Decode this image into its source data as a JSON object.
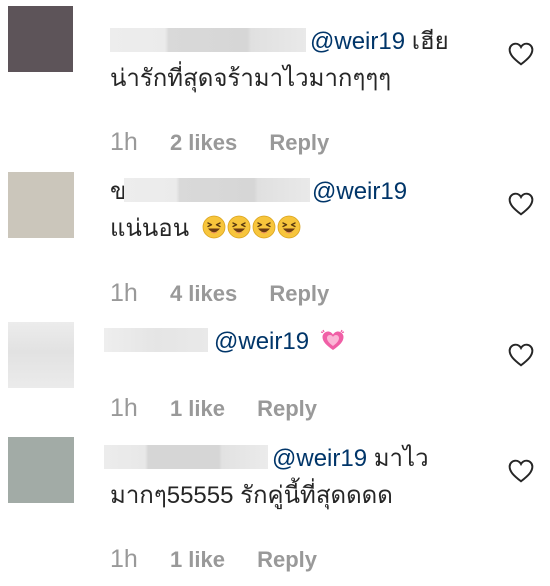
{
  "comments": [
    {
      "avatar_color": "#5d5459",
      "line1": "เฮีย",
      "mention": "@weir19",
      "line2": "น่ารักที่สุดจร้ามาไวมากๆๆๆ",
      "time": "1h",
      "likes": "2 likes",
      "reply": "Reply"
    },
    {
      "avatar_color": "#cbc6bb",
      "lead_char": "ข",
      "mention": "@weir19",
      "line2": "แน่นอน",
      "emoji_count": 4,
      "emoji_name": "laughing-face-emoji",
      "time": "1h",
      "likes": "4 likes",
      "reply": "Reply"
    },
    {
      "avatar_color": "#e6e6e6",
      "mention": "@weir19",
      "emoji_name": "sparkling-heart-emoji",
      "time": "1h",
      "likes": "1 like",
      "reply": "Reply"
    },
    {
      "avatar_color": "#a2aba6",
      "line1": "มาไว",
      "mention": "@weir19",
      "line2": "มากๆ55555 รักคู่นี้ที่สุดดดด",
      "time": "1h",
      "likes": "1 like",
      "reply": "Reply"
    }
  ],
  "colors": {
    "mention": "#003569",
    "meta": "#999999",
    "text": "#262626",
    "heart_outline": "#262626"
  },
  "icons": {
    "like": "heart-outline-icon"
  }
}
